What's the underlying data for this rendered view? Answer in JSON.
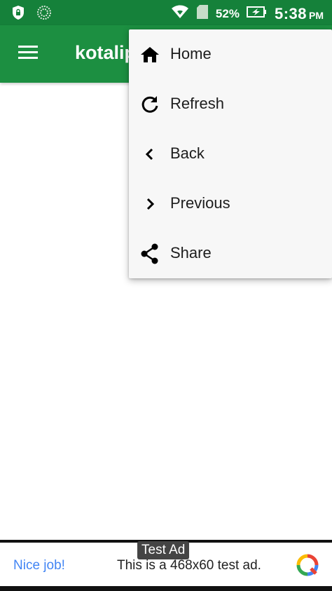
{
  "status_bar": {
    "battery_percent": "52%",
    "time": "5:38",
    "ampm": "PM",
    "icons": [
      "shield-icon",
      "sync-icon",
      "wifi-icon",
      "signal-icon",
      "battery-charging-icon"
    ]
  },
  "app_bar": {
    "title": "kotalip",
    "menu_icon": "hamburger-menu-icon"
  },
  "menu": {
    "items": [
      {
        "label": "Home",
        "icon": "home-icon"
      },
      {
        "label": "Refresh",
        "icon": "refresh-icon"
      },
      {
        "label": "Back",
        "icon": "chevron-left-icon"
      },
      {
        "label": "Previous",
        "icon": "chevron-right-icon"
      },
      {
        "label": "Share",
        "icon": "share-icon"
      }
    ]
  },
  "ad": {
    "badge": "Test Ad",
    "headline": "Nice job!",
    "body": "This is a 468x60 test ad.",
    "logo_icon": "adchoices-logo-icon"
  },
  "colors": {
    "status_bar": "#15813a",
    "app_bar": "#1c8f41",
    "menu_bg": "#f7f7f7",
    "ad_headline": "#4285f4"
  }
}
